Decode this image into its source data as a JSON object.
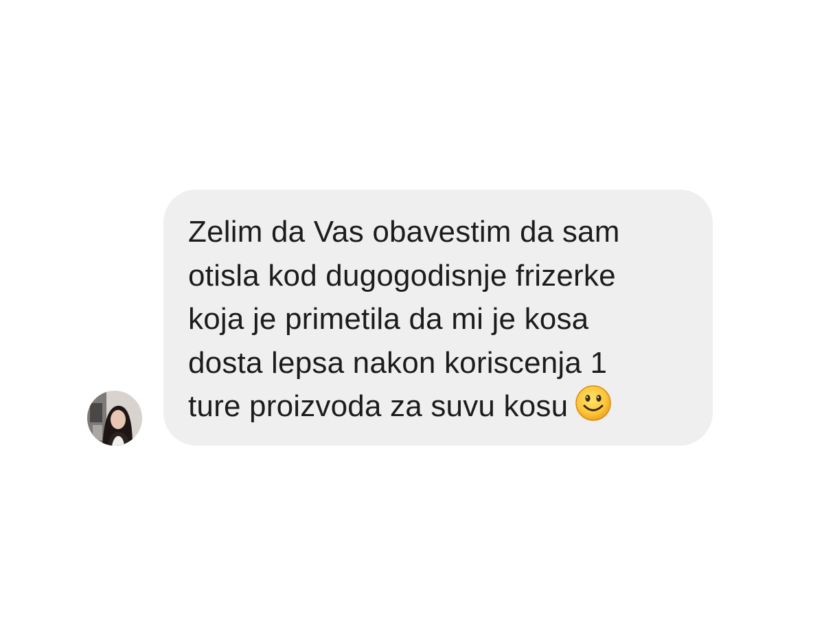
{
  "message": {
    "lines": [
      "Zelim da Vas obavestim da sam",
      "otisla kod dugogodisnje frizerke",
      "koja je primetila da mi je kosa",
      "dosta lepsa nakon koriscenja 1",
      "ture proizvoda za suvu kosu"
    ],
    "emoji": "slightly-smiling-face-icon",
    "bubble_color": "#efefef",
    "text_color": "#1c1c1c"
  },
  "sender": {
    "avatar": "avatar-photo"
  }
}
